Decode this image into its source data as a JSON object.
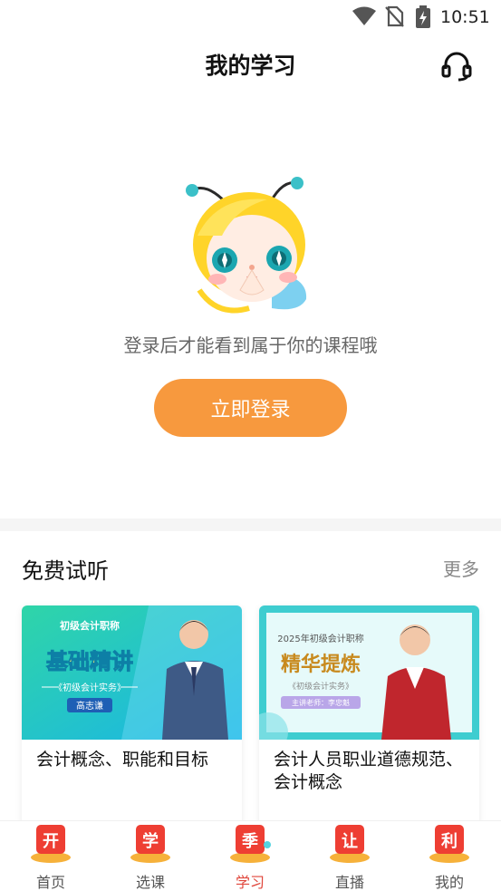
{
  "status_bar": {
    "time": "10:51",
    "icons": [
      "wifi-icon",
      "no-sim-icon",
      "battery-charging-icon"
    ]
  },
  "header": {
    "title": "我的学习",
    "support_icon": "headset-icon"
  },
  "login": {
    "prompt": "登录后才能看到属于你的课程哦",
    "button_label": "立即登录",
    "button_color": "#F7993E"
  },
  "free_trial": {
    "title": "免费试听",
    "more_label": "更多",
    "courses": [
      {
        "title": "会计概念、职能和目标",
        "thumb_series": "初级会计职称",
        "thumb_heading": "基础精讲",
        "thumb_subject": "《初级会计实务》",
        "thumb_teacher": "高志谦"
      },
      {
        "title": "会计人员职业道德规范、会计概念",
        "thumb_series": "2025年初级会计职称",
        "thumb_heading": "精华提炼",
        "thumb_subject": "《初级会计实务》",
        "thumb_teacher": "主讲老师：李忠魁"
      }
    ]
  },
  "bottom_nav": {
    "active_color": "#E0463B",
    "items": [
      {
        "label": "首页",
        "badge": "开"
      },
      {
        "label": "选课",
        "badge": "学"
      },
      {
        "label": "学习",
        "badge": "季",
        "active": true
      },
      {
        "label": "直播",
        "badge": "让"
      },
      {
        "label": "我的",
        "badge": "利"
      }
    ]
  }
}
